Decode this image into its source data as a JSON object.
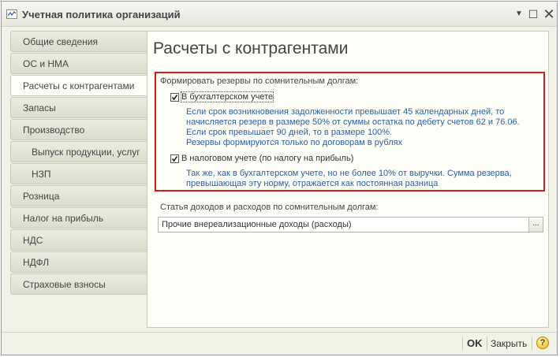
{
  "window": {
    "title": "Учетная политика организаций",
    "controls": {
      "menu": "▼",
      "maximize": "☐",
      "close": "✕"
    }
  },
  "sidebar": {
    "items": [
      {
        "label": "Общие сведения",
        "active": false,
        "sub": false
      },
      {
        "label": "ОС и НМА",
        "active": false,
        "sub": false
      },
      {
        "label": "Расчеты с контрагентами",
        "active": true,
        "sub": false
      },
      {
        "label": "Запасы",
        "active": false,
        "sub": false
      },
      {
        "label": "Производство",
        "active": false,
        "sub": false
      },
      {
        "label": "Выпуск продукции, услуг",
        "active": false,
        "sub": true
      },
      {
        "label": "НЗП",
        "active": false,
        "sub": true
      },
      {
        "label": "Розница",
        "active": false,
        "sub": false
      },
      {
        "label": "Налог на прибыль",
        "active": false,
        "sub": false
      },
      {
        "label": "НДС",
        "active": false,
        "sub": false
      },
      {
        "label": "НДФЛ",
        "active": false,
        "sub": false
      },
      {
        "label": "Страховые взносы",
        "active": false,
        "sub": false
      }
    ]
  },
  "main": {
    "title": "Расчеты с контрагентами",
    "reserves": {
      "group_label": "Формировать резервы по сомнительным долгам:",
      "accounting": {
        "label": "В бухгалтерском учете",
        "checked": true,
        "hint": [
          "Если срок возникновения задолженности превышает 45 календарных дней, то",
          "начисляется резерв в размере 50% от суммы остатка по дебету счетов 62 и 76.06.",
          "Если срок превышает 90 дней, то в размере 100%.",
          "Резервы формируются только по договорам в рублях"
        ]
      },
      "tax": {
        "label": "В налоговом учете (по налогу на прибыль)",
        "checked": true,
        "hint": [
          "Так же, как в бухгалтерском учете, но не более 10% от выручки. Сумма резерва,",
          "превышающая эту норму, отражается как постоянная разница"
        ]
      }
    },
    "expense_item": {
      "label": "Статья доходов и расходов по сомнительным долгам:",
      "value": "Прочие внереализационные доходы (расходы)",
      "button": "..."
    }
  },
  "footer": {
    "ok_label": "OK",
    "close_label": "Закрыть",
    "help_label": "?"
  },
  "colors": {
    "highlight_border": "#d9181e",
    "hint_text": "#2a5fa8",
    "window_bg": "#f2f2e6"
  }
}
